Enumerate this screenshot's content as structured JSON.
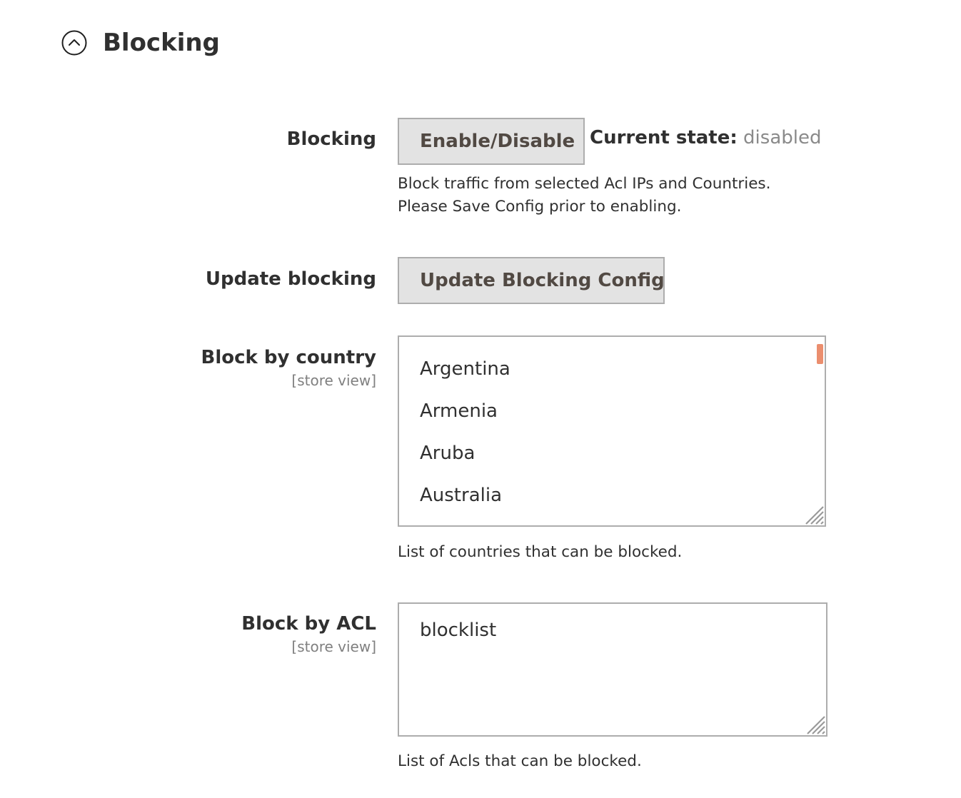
{
  "section": {
    "title": "Blocking",
    "icon": "chevron-up-circle-icon"
  },
  "blocking": {
    "label": "Blocking",
    "button_label": "Enable/Disable",
    "state_label": "Current state:",
    "state_value": "disabled",
    "note_line1": "Block traffic from selected Acl IPs and Countries.",
    "note_line2": "Please Save Config prior to enabling."
  },
  "update_blocking": {
    "label": "Update blocking",
    "button_label": "Update Blocking Config"
  },
  "block_by_country": {
    "label": "Block by country",
    "scope": "[store view]",
    "options": [
      "Argentina",
      "Armenia",
      "Aruba",
      "Australia"
    ],
    "note": "List of countries that can be blocked.",
    "scrollbar_color": "#eb8e6e"
  },
  "block_by_acl": {
    "label": "Block by ACL",
    "scope": "[store view]",
    "value": "blocklist",
    "note": "List of Acls that can be blocked."
  }
}
